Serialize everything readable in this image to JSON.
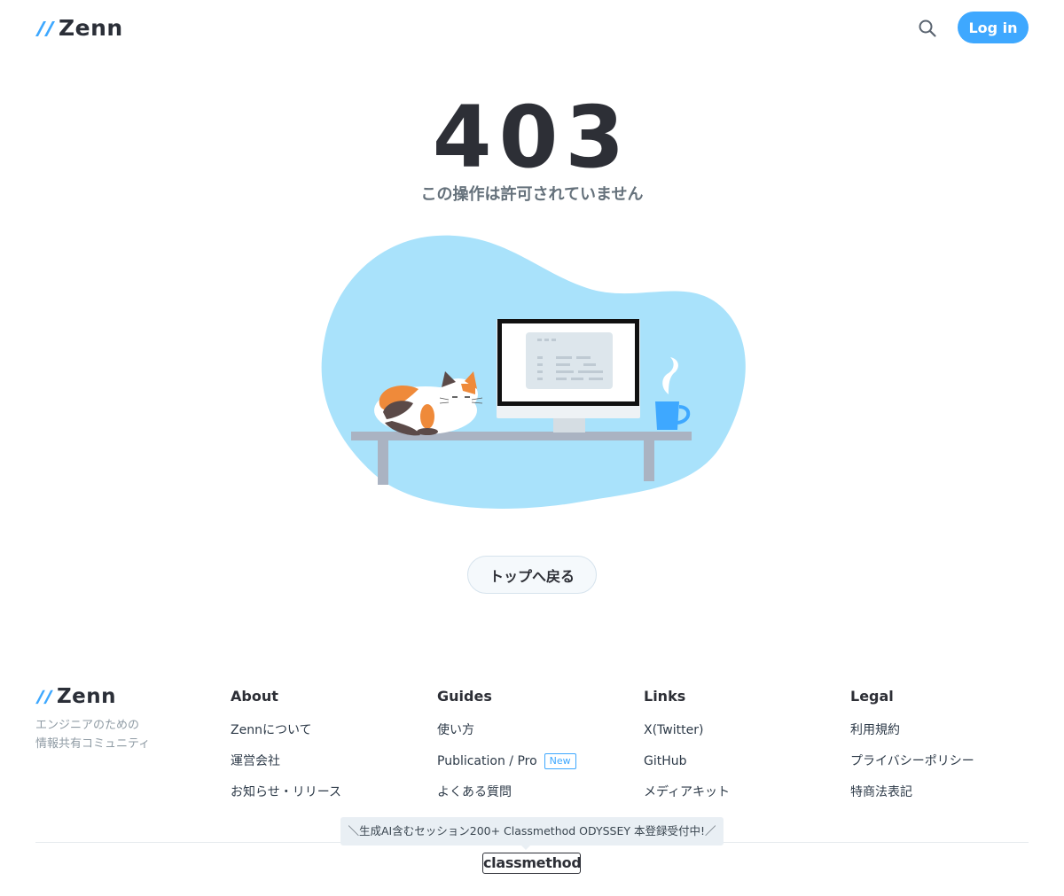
{
  "header": {
    "logo_text": "Zenn",
    "search_icon": "search-icon",
    "login_label": "Log in"
  },
  "error": {
    "code": "403",
    "message": "この操作は許可されていません"
  },
  "back_button": "トップへ戻る",
  "footer": {
    "logo_text": "Zenn",
    "tagline_line1": "エンジニアのための",
    "tagline_line2": "情報共有コミュニティ",
    "columns": [
      {
        "title": "About",
        "items": [
          "Zennについて",
          "運営会社",
          "お知らせ・リリース"
        ]
      },
      {
        "title": "Guides",
        "items": [
          "使い方",
          "Publication / Pro",
          "よくある質問"
        ],
        "badge": "New"
      },
      {
        "title": "Links",
        "items": [
          "X(Twitter)",
          "GitHub",
          "メディアキット"
        ]
      },
      {
        "title": "Legal",
        "items": [
          "利用規約",
          "プライバシーポリシー",
          "特商法表記"
        ]
      }
    ],
    "banner": "＼生成AI含むセッション200+ Classmethod ODYSSEY 本登録受付中!／",
    "sponsor_logo": "classmethod"
  },
  "colors": {
    "accent": "#3ea8ff",
    "blob": "#a9e2fb",
    "cat_orange": "#ef8a3a",
    "cat_dark": "#5b4a48"
  }
}
